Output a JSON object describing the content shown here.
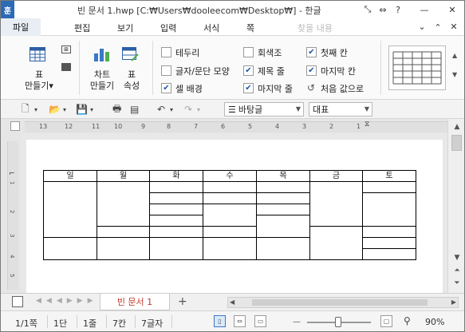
{
  "window": {
    "app_logo": "훈",
    "title": "빈 문서 1.hwp [C:₩Users₩dooleecom₩Desktop₩] - 한글",
    "title_buttons": [
      "zoom-icon",
      "expand-icon",
      "help-icon",
      "minimize-icon",
      "close-icon"
    ]
  },
  "menubar": {
    "items": [
      "파일",
      "편집",
      "보기",
      "입력",
      "서식",
      "쪽"
    ],
    "find_label": "찾을 내용",
    "right_icons": [
      "chevron-down-icon",
      "chevron-up-icon",
      "close-icon"
    ]
  },
  "ribbon": {
    "table_button": "표\n만들기",
    "chart_button": "차트\n만들기",
    "table_props_button": "표\n속성",
    "checkboxes": [
      {
        "label": "테두리",
        "checked": false
      },
      {
        "label": "글자/문단 모양",
        "checked": false
      },
      {
        "label": "셀 배경",
        "checked": true
      },
      {
        "label": "회색조",
        "checked": false
      },
      {
        "label": "제목 줄",
        "checked": true
      },
      {
        "label": "마지막 줄",
        "checked": true
      },
      {
        "label": "첫째 칸",
        "checked": true
      },
      {
        "label": "마지막 칸",
        "checked": true
      }
    ],
    "reset_label": "처음 값으로"
  },
  "toolbar": {
    "style_combo": "바탕글",
    "font_combo": "대표"
  },
  "ruler": {
    "numbers": [
      "13",
      "12",
      "11",
      "10",
      "9",
      "8",
      "7",
      "6",
      "5",
      "4",
      "3",
      "2",
      "1"
    ],
    "vertical_numbers": [
      "1",
      "2",
      "3",
      "4",
      "5"
    ]
  },
  "table": {
    "headers": [
      "일",
      "월",
      "화",
      "수",
      "목",
      "금",
      "토"
    ]
  },
  "tabs": {
    "doc_tab": "빈 문서 1",
    "add": "+"
  },
  "statusbar": {
    "page": "1/1쪽",
    "section": "1단",
    "line": "1줄",
    "column": "7칸",
    "chars": "7글자",
    "zoom": "90%"
  }
}
